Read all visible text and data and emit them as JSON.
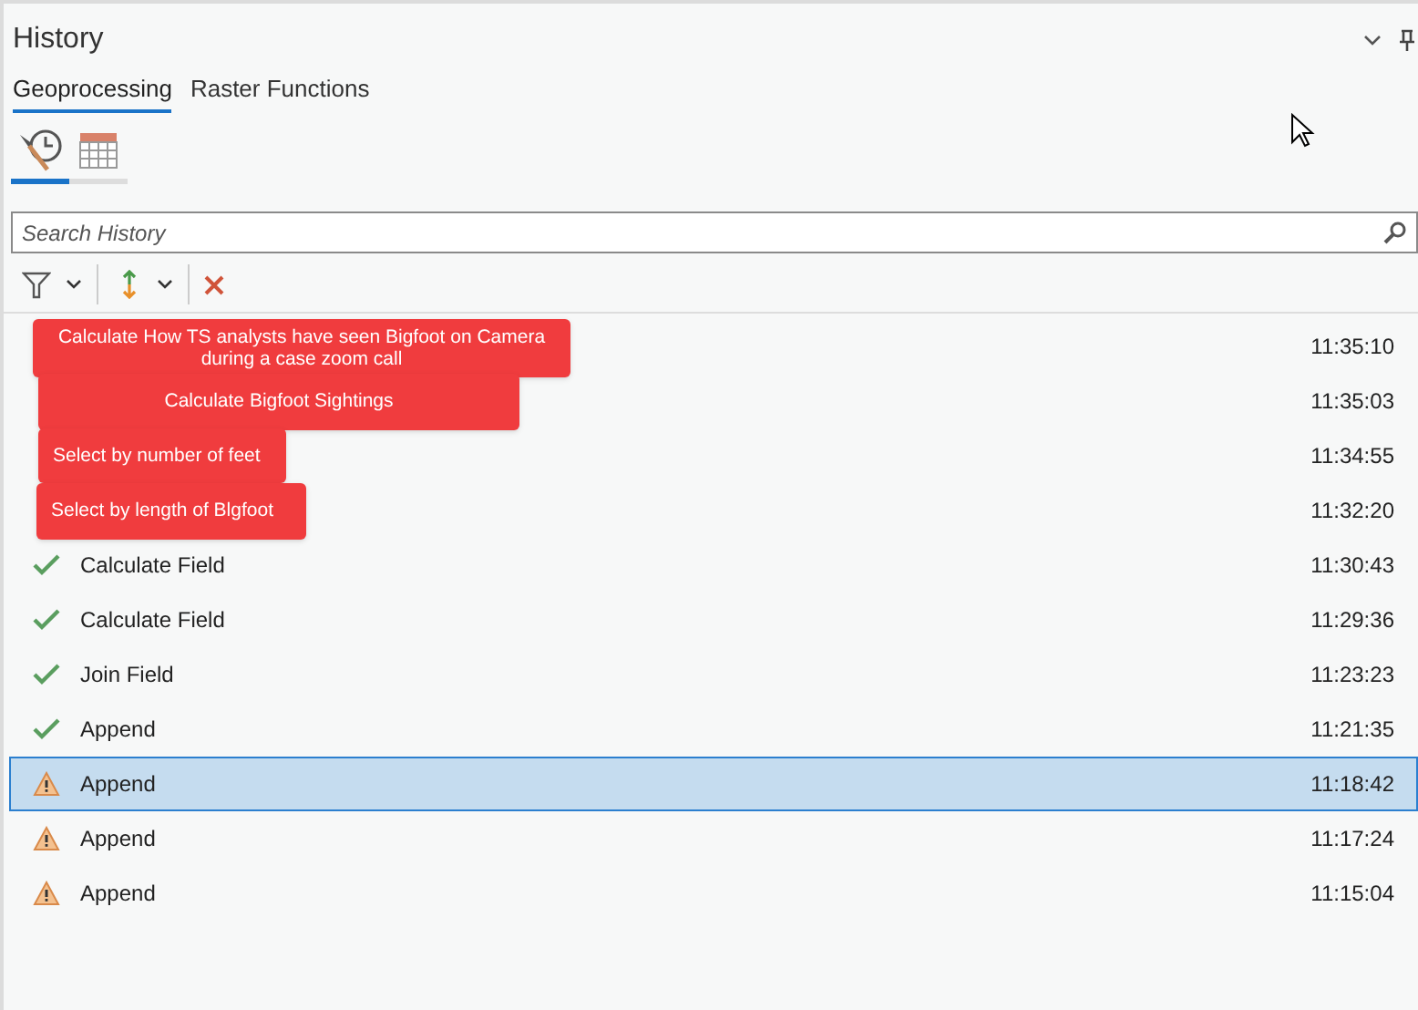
{
  "panel": {
    "title": "History"
  },
  "tabs": [
    {
      "label": "Geoprocessing",
      "selected": true
    },
    {
      "label": "Raster Functions",
      "selected": false
    }
  ],
  "view_tabs": [
    {
      "kind": "history",
      "selected": true
    },
    {
      "kind": "calendar",
      "selected": false
    }
  ],
  "search": {
    "placeholder": "Search History"
  },
  "rows": [
    {
      "annotation": "Calculate How TS analysts have seen Bigfoot on Camera during a case zoom call",
      "time": "11:35:10",
      "selected": false
    },
    {
      "annotation": "Calculate Bigfoot Sightings",
      "time": "11:35:03",
      "selected": false
    },
    {
      "annotation": "Select by number of feet",
      "time": "11:34:55",
      "selected": false
    },
    {
      "annotation": "Select by length of  Blgfoot",
      "time": "11:32:20",
      "selected": false
    },
    {
      "kind": "success",
      "name": "Calculate Field",
      "time": "11:30:43",
      "selected": false
    },
    {
      "kind": "success",
      "name": "Calculate Field",
      "time": "11:29:36",
      "selected": false
    },
    {
      "kind": "success",
      "name": "Join Field",
      "time": "11:23:23",
      "selected": false
    },
    {
      "kind": "success",
      "name": "Append",
      "time": "11:21:35",
      "selected": false
    },
    {
      "kind": "warning",
      "name": "Append",
      "time": "11:18:42",
      "selected": true
    },
    {
      "kind": "warning",
      "name": "Append",
      "time": "11:17:24",
      "selected": false
    },
    {
      "kind": "warning",
      "name": "Append",
      "time": "11:15:04",
      "selected": false
    }
  ]
}
